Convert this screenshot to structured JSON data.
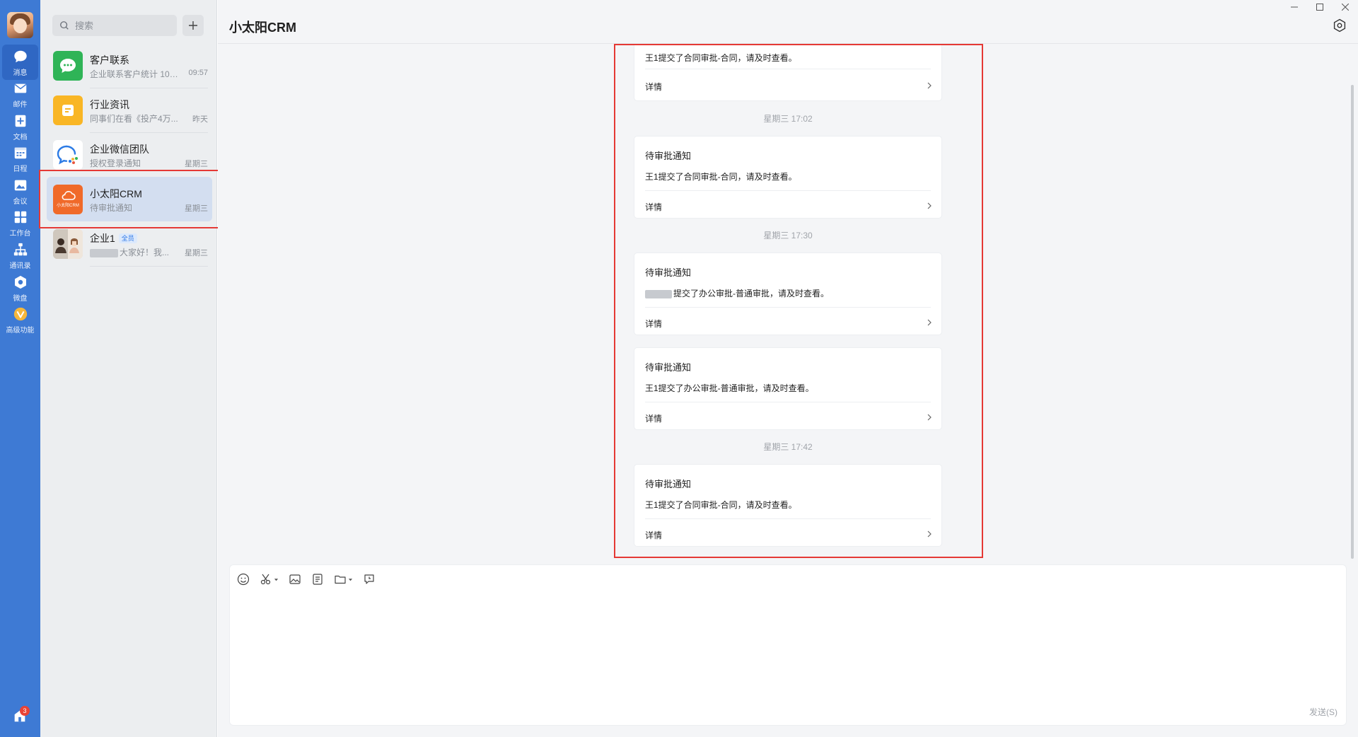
{
  "rail": {
    "items": [
      {
        "label": "消息",
        "icon": "chat-bubble-icon",
        "active": true
      },
      {
        "label": "邮件",
        "icon": "mail-icon"
      },
      {
        "label": "文档",
        "icon": "document-icon"
      },
      {
        "label": "日程",
        "icon": "calendar-icon"
      },
      {
        "label": "会议",
        "icon": "meeting-icon"
      },
      {
        "label": "工作台",
        "icon": "workbench-grid-icon"
      },
      {
        "label": "通讯录",
        "icon": "org-chart-icon"
      },
      {
        "label": "微盘",
        "icon": "drive-icon"
      },
      {
        "label": "高级功能",
        "icon": "premium-icon"
      }
    ],
    "bottom_badge": "3"
  },
  "search": {
    "placeholder": "搜索"
  },
  "conversations": [
    {
      "name": "客户联系",
      "preview": "企业联系客户统计 10....",
      "time": "09:57",
      "icon": "green-chat-icon"
    },
    {
      "name": "行业资讯",
      "preview": "同事们在看《投产4万...",
      "time": "昨天",
      "icon": "yellow-news-icon"
    },
    {
      "name": "企业微信团队",
      "preview": "授权登录通知",
      "time": "星期三",
      "icon": "wecom-logo-icon"
    },
    {
      "name": "小太阳CRM",
      "preview": "待审批通知",
      "time": "星期三",
      "icon": "crm-cloud-icon",
      "icon_text": "小太阳CRM",
      "selected": true
    },
    {
      "name": "企业1",
      "tag": "全员",
      "preview": "大家好！我...",
      "time": "星期三",
      "icon": "group-avatar-icon"
    }
  ],
  "chat": {
    "title": "小太阳CRM",
    "messages": [
      {
        "type": "card",
        "body": "王1提交了合同审批-合同，请及时查看。",
        "link": "详情"
      },
      {
        "type": "timestamp",
        "text": "星期三 17:02"
      },
      {
        "type": "card",
        "title": "待审批通知",
        "body": "王1提交了合同审批-合同，请及时查看。",
        "link": "详情"
      },
      {
        "type": "timestamp",
        "text": "星期三 17:30"
      },
      {
        "type": "card",
        "title": "待审批通知",
        "body": "提交了办公审批-普通审批，请及时查看。",
        "link": "详情"
      },
      {
        "type": "card",
        "title": "待审批通知",
        "body": "王1提交了办公审批-普通审批，请及时查看。",
        "link": "详情"
      },
      {
        "type": "timestamp",
        "text": "星期三 17:42"
      },
      {
        "type": "card",
        "title": "待审批通知",
        "body": "王1提交了合同审批-合同，请及时查看。",
        "link": "详情"
      }
    ]
  },
  "composer": {
    "toolbar": [
      "emoji-icon",
      "scissors-screenshot-icon",
      "image-icon",
      "note-icon",
      "folder-icon",
      "chat-history-icon"
    ],
    "send_label": "发送(S)"
  },
  "colors": {
    "rail": "#3e7ad4",
    "selected_conv": "#d3def0",
    "highlight": "#e53935"
  }
}
